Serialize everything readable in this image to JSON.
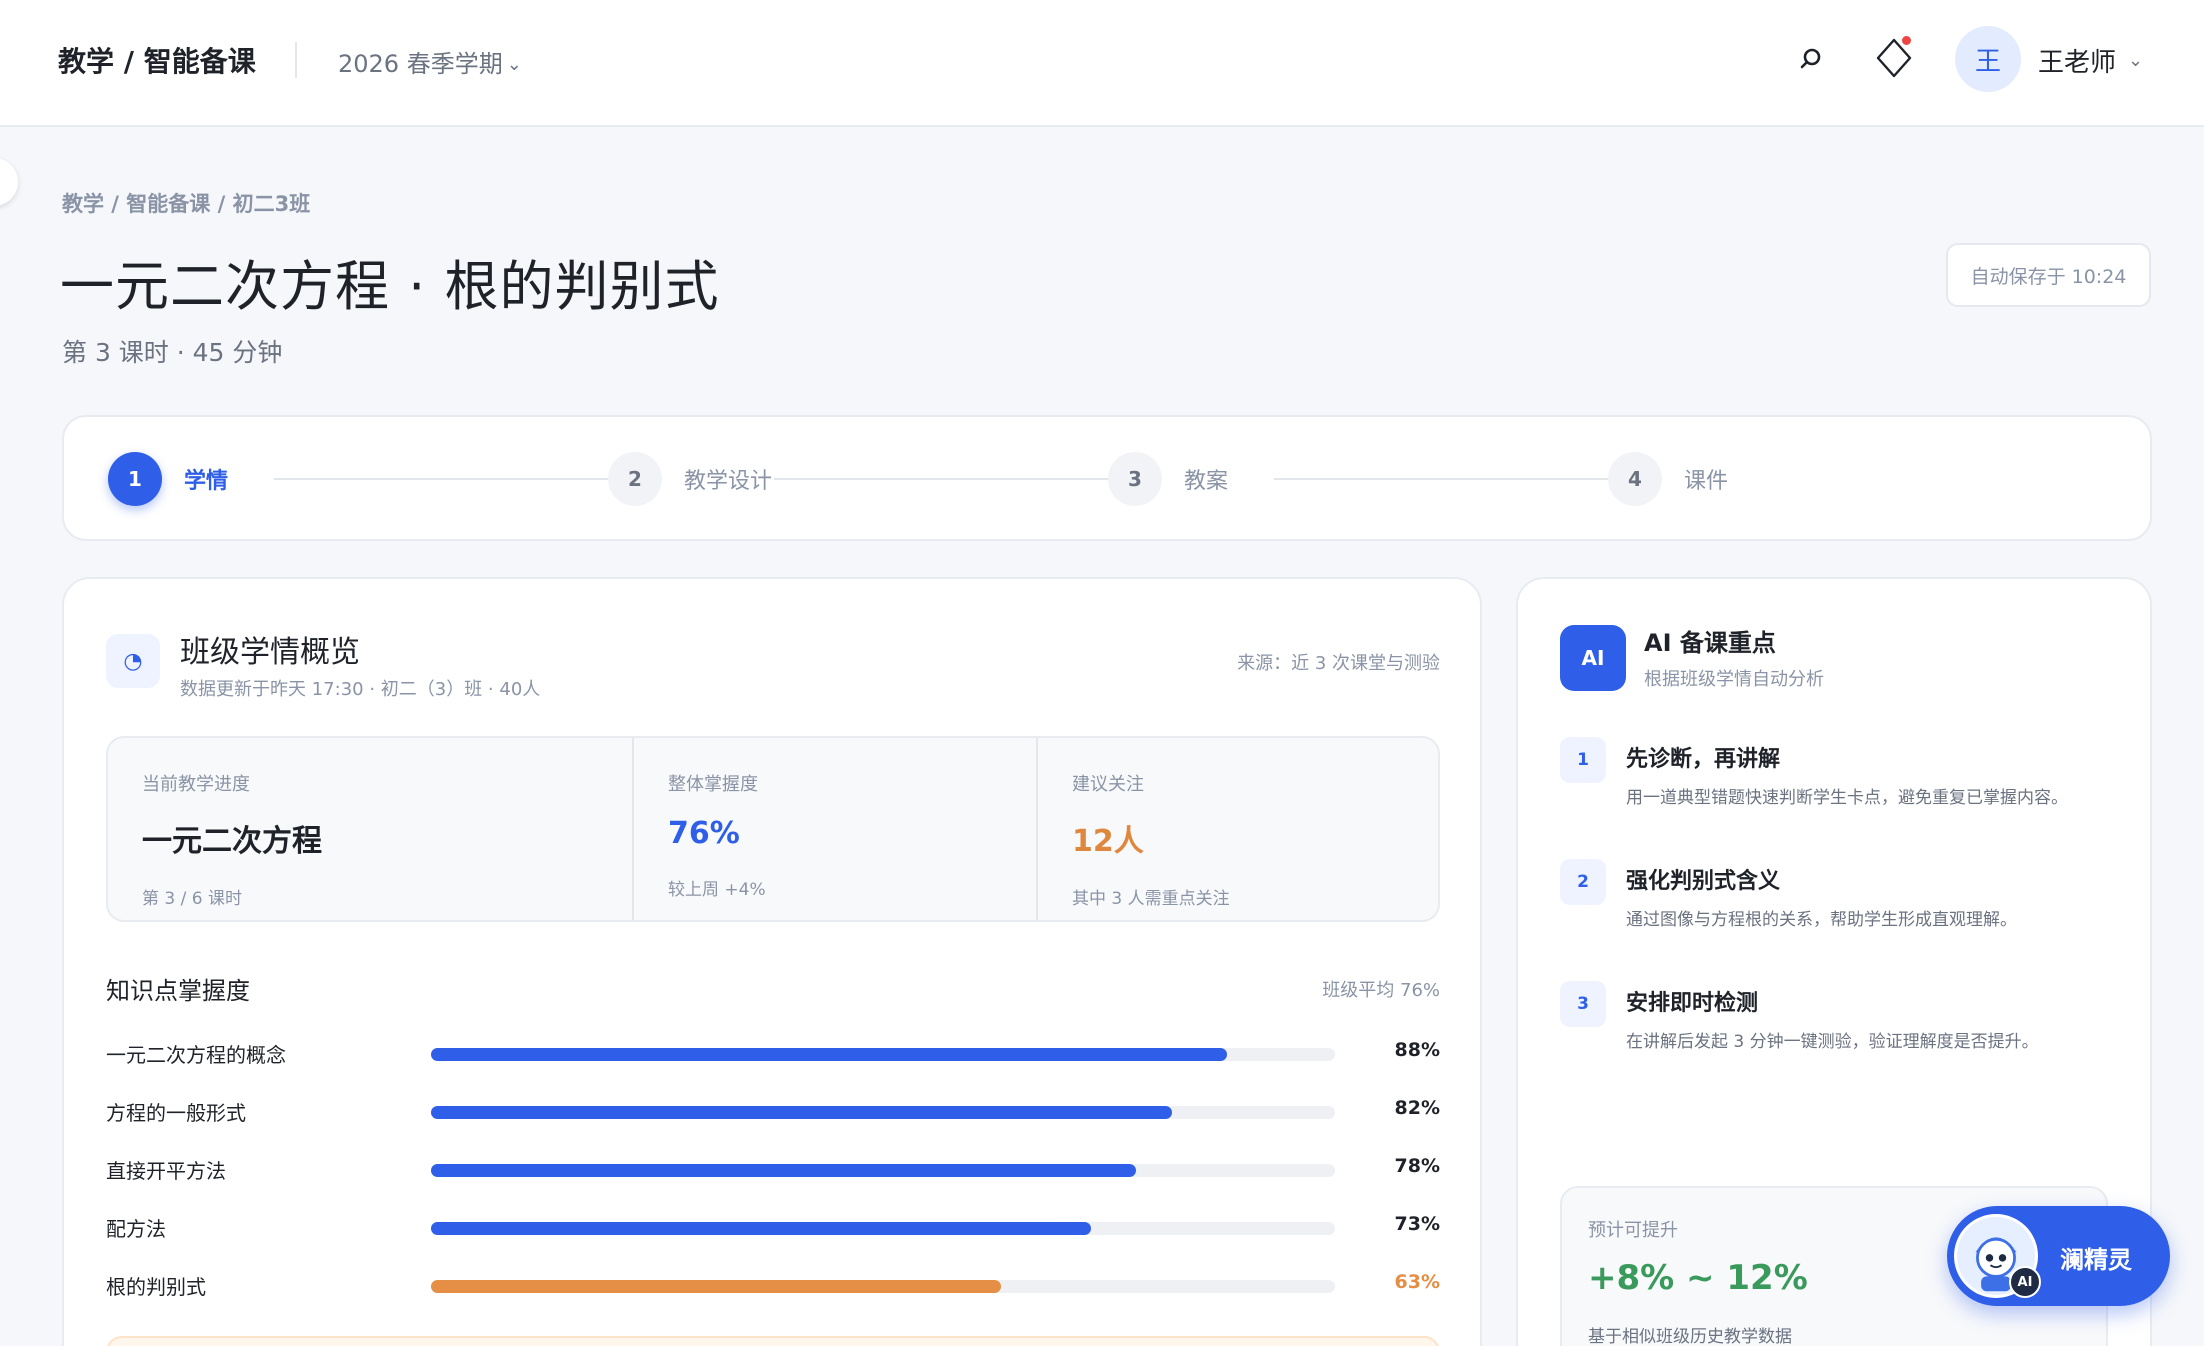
{
  "topbar": {
    "app_title": "教学 / 智能备课",
    "term": "2026 春季学期",
    "term_chevron": "⌄",
    "avatar_char": "王",
    "user_name": "王老师",
    "user_chevron": "⌄",
    "icons": [
      "search-icon",
      "bell-icon",
      "notification-dot",
      "avatar",
      "chevron-down-icon"
    ]
  },
  "header": {
    "breadcrumb": "教学 / 智能备课 / 初二3班",
    "title": "一元二次方程 · 根的判别式",
    "subtitle": "第 3 课时 · 45 分钟",
    "autosave": "自动保存于 10:24"
  },
  "stepper": {
    "steps": [
      {
        "num": "1",
        "label": "学情",
        "active": true
      },
      {
        "num": "2",
        "label": "教学设计",
        "active": false
      },
      {
        "num": "3",
        "label": "教案",
        "active": false
      },
      {
        "num": "4",
        "label": "课件",
        "active": false
      }
    ]
  },
  "overview": {
    "icon": "pie-chart-icon",
    "icon_glyph": "◔",
    "title": "班级学情概览",
    "subtitle": "数据更新于昨天 17:30 · 初二（3）班 · 40人",
    "source": "来源：近 3 次课堂与测验",
    "stats": [
      {
        "label": "当前教学进度",
        "value": "一元二次方程",
        "note": "第 3 / 6 课时"
      },
      {
        "label": "整体掌握度",
        "value": "76%",
        "note": "较上周 +4%"
      },
      {
        "label": "建议关注",
        "value": "12人",
        "note": "其中 3 人需重点关注"
      }
    ],
    "mastery_title": "知识点掌握度",
    "mastery_avg": "班级平均 76%",
    "mastery": [
      {
        "name": "一元二次方程的概念",
        "value": 88,
        "label": "88%",
        "warn": false
      },
      {
        "name": "方程的一般形式",
        "value": 82,
        "label": "82%",
        "warn": false
      },
      {
        "name": "直接开平方法",
        "value": 78,
        "label": "78%",
        "warn": false
      },
      {
        "name": "配方法",
        "value": 73,
        "label": "73%",
        "warn": false
      },
      {
        "name": "根的判别式",
        "value": 63,
        "label": "63%",
        "warn": true
      }
    ]
  },
  "ai_panel": {
    "badge": "AI",
    "title": "AI 备课重点",
    "subtitle": "根据班级学情自动分析",
    "tips": [
      {
        "num": "1",
        "title": "先诊断，再讲解",
        "desc": "用一道典型错题快速判断学生卡点，避免重复已掌握内容。"
      },
      {
        "num": "2",
        "title": "强化判别式含义",
        "desc": "通过图像与方程根的关系，帮助学生形成直观理解。"
      },
      {
        "num": "3",
        "title": "安排即时检测",
        "desc": "在讲解后发起 3 分钟一键测验，验证理解度是否提升。"
      }
    ],
    "gain_label": "预计可提升",
    "gain_value": "+8% ~ 12%",
    "gain_note": "基于相似班级历史教学数据"
  },
  "assistant": {
    "name": "澜精灵",
    "badge": "AI"
  },
  "colors": {
    "accent": "#2f5fe8",
    "warning": "#e58e45",
    "success": "#3a9a5c"
  }
}
